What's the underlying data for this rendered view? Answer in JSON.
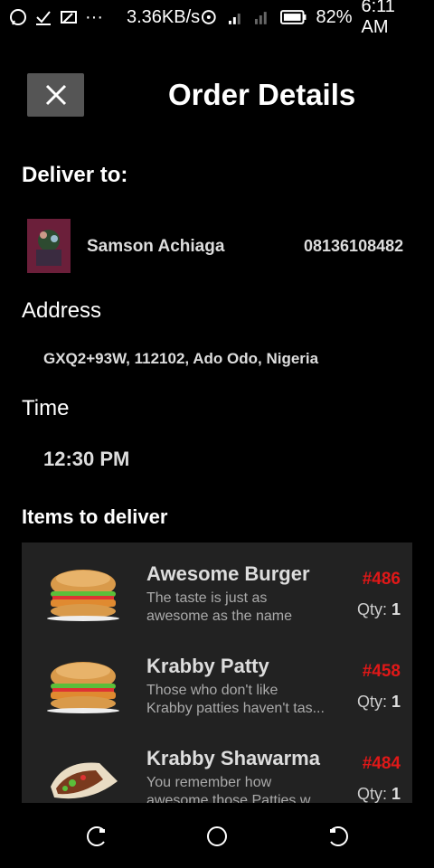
{
  "status_bar": {
    "speed": "3.36KB/s",
    "battery": "82%",
    "time": "6:11 AM"
  },
  "header": {
    "title": "Order Details",
    "close_icon": "close-icon"
  },
  "deliver_to": {
    "label": "Deliver to:",
    "name": "Samson Achiaga",
    "phone": "08136108482"
  },
  "address": {
    "label": "Address",
    "value": "GXQ2+93W, 112102, Ado Odo, Nigeria"
  },
  "time": {
    "label": "Time",
    "value": "12:30 PM"
  },
  "items_section": {
    "label": "Items to deliver",
    "qty_label": "Qty:",
    "items": [
      {
        "name": "Awesome Burger",
        "desc_line1": "The taste is just as",
        "desc_line2": "awesome as the name",
        "price": "#486",
        "qty": "1",
        "icon": "burger-icon"
      },
      {
        "name": "Krabby Patty",
        "desc_line1": "Those who don't like",
        "desc_line2": "Krabby patties haven't tas...",
        "price": "#458",
        "qty": "1",
        "icon": "burger-icon"
      },
      {
        "name": "Krabby Shawarma",
        "desc_line1": "You remember how",
        "desc_line2": "awesome those Patties w...",
        "price": "#484",
        "qty": "1",
        "icon": "shawarma-icon"
      }
    ]
  },
  "colors": {
    "background": "#000000",
    "panel": "#222222",
    "price": "#e01818",
    "close_button": "#555555"
  }
}
